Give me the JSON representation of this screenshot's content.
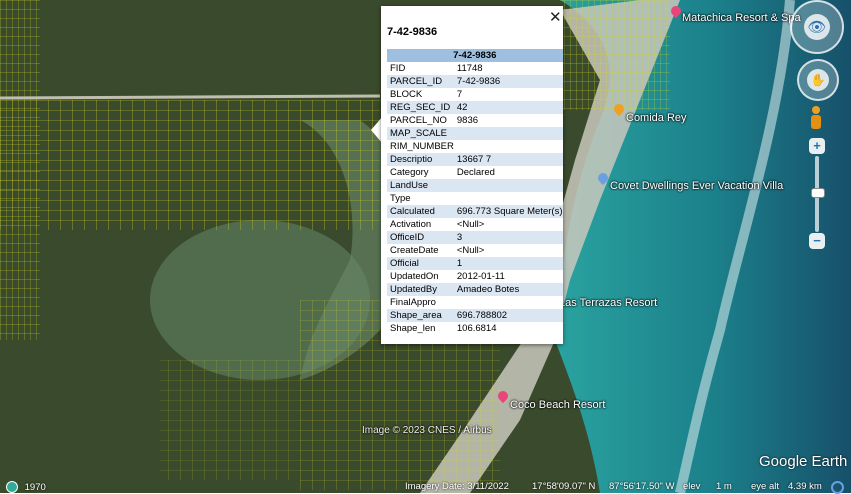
{
  "map": {
    "places": [
      {
        "name": "Matachica Resort & Spa",
        "pin_color": "#e8457a"
      },
      {
        "name": "Comida Rey",
        "pin_color": "#f0a020"
      },
      {
        "name": "Covet Dwellings Ever Vacation Villa",
        "pin_color": "#6aa0e0"
      },
      {
        "name": "Las Terrazas Resort",
        "pin_color": "#e8457a"
      },
      {
        "name": "Coco Beach Resort",
        "pin_color": "#e8457a"
      }
    ],
    "attribution": "Image © 2023 CNES / Airbus",
    "colors": {
      "land": "#3d4a2e",
      "parcel_lines": "#e0e020",
      "water": "#1c8b8a",
      "deep_water": "#18506a",
      "sand": "#d8d6c8"
    }
  },
  "popup": {
    "title": "7-42-9836",
    "table_header": "7-42-9836",
    "close_icon": "✕",
    "rows": [
      {
        "key": "FID",
        "value": "11748"
      },
      {
        "key": "PARCEL_ID",
        "value": "7-42-9836"
      },
      {
        "key": "BLOCK",
        "value": "7"
      },
      {
        "key": "REG_SEC_ID",
        "value": "42"
      },
      {
        "key": "PARCEL_NO",
        "value": "9836"
      },
      {
        "key": "MAP_SCALE",
        "value": ""
      },
      {
        "key": "RIM_NUMBER",
        "value": ""
      },
      {
        "key": "Descriptio",
        "value": "13667 7"
      },
      {
        "key": "Category",
        "value": "Declared"
      },
      {
        "key": "LandUse",
        "value": ""
      },
      {
        "key": "Type",
        "value": ""
      },
      {
        "key": "Calculated",
        "value": "696.773 Square Meter(s)"
      },
      {
        "key": "Activation",
        "value": "<Null>"
      },
      {
        "key": "OfficeID",
        "value": "3"
      },
      {
        "key": "CreateDate",
        "value": "<Null>"
      },
      {
        "key": "Official",
        "value": "1"
      },
      {
        "key": "UpdatedOn",
        "value": "2012-01-11"
      },
      {
        "key": "UpdatedBy",
        "value": "Amadeo Botes"
      },
      {
        "key": "FinalAppro",
        "value": ""
      },
      {
        "key": "Shape_area",
        "value": "696.788802"
      },
      {
        "key": "Shape_len",
        "value": "106.6814"
      }
    ]
  },
  "status": {
    "year": "1970",
    "imagery_date": "Imagery Date: 3/11/2022",
    "lat": "17°58'09.07\" N",
    "lon": "87°56'17.50\" W",
    "elev": "elev",
    "elev_value": "1 m",
    "eye_alt": "eye alt",
    "eye_alt_value": "4.39 km",
    "logo": "Google Earth"
  },
  "nav": {
    "look_icon": "look-joystick-icon",
    "move_icon": "move-joystick-icon",
    "pegman_icon": "pegman-icon",
    "zoom_in": "+",
    "zoom_out": "−"
  }
}
